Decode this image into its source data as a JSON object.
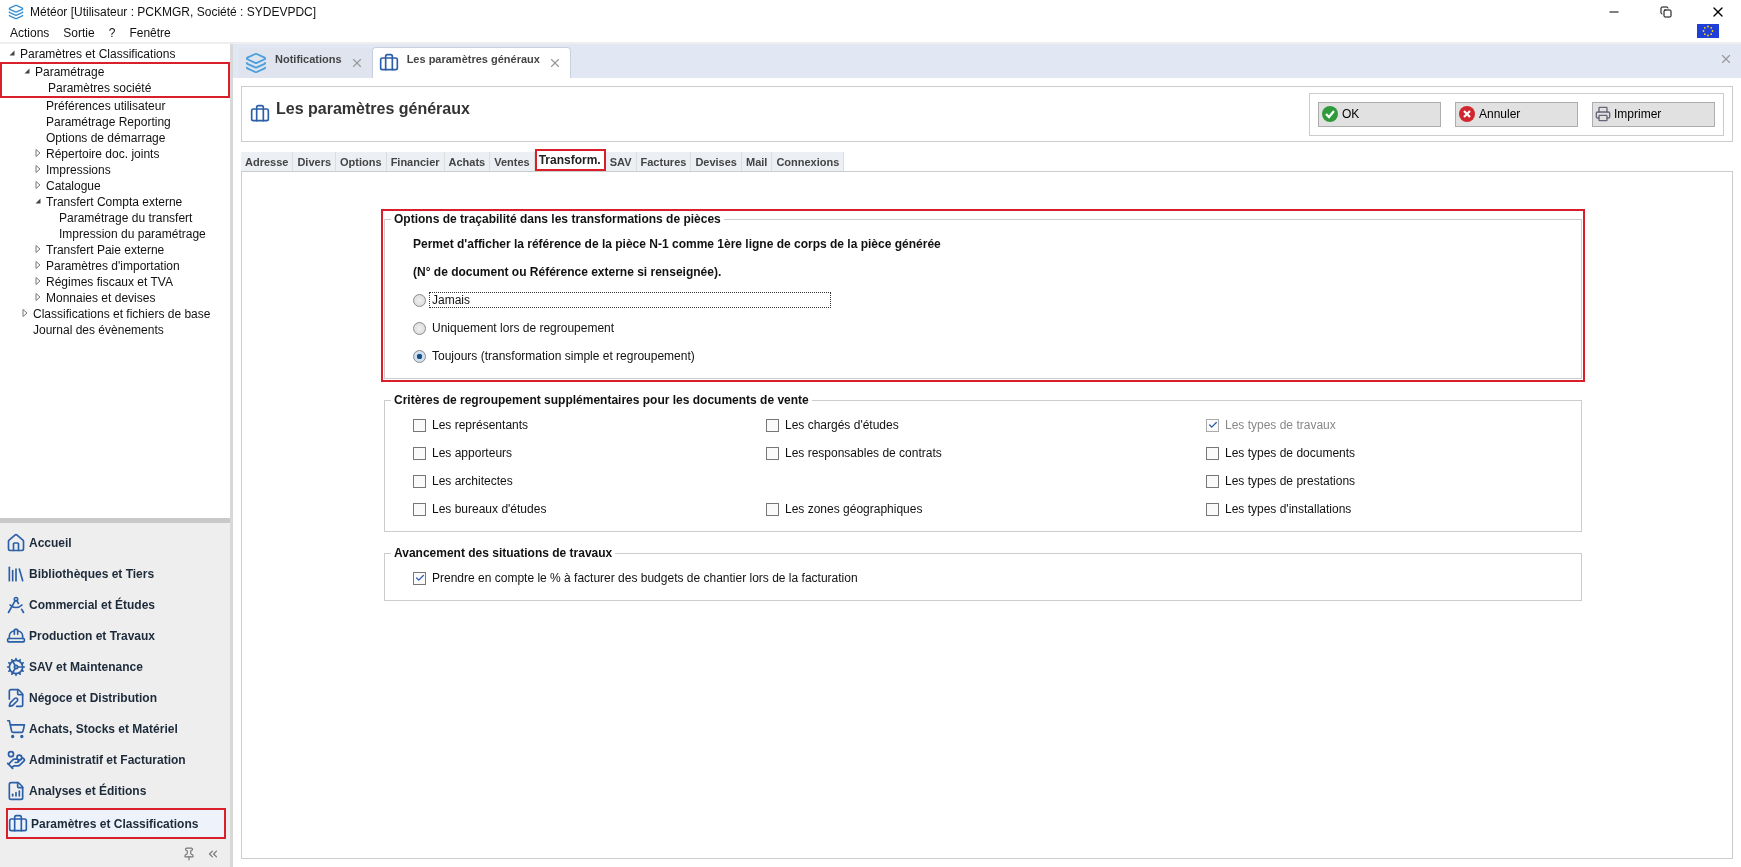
{
  "window": {
    "title": "Météor [Utilisateur : PCKMGR, Société : SYDEVPDC]"
  },
  "menu": [
    "Actions",
    "Sortie",
    "?",
    "Fenêtre"
  ],
  "tree": [
    {
      "label": "Paramètres et Classifications",
      "expanded": true,
      "children": [
        {
          "label": "Paramétrage",
          "expanded": true,
          "highlighted": true,
          "children": [
            {
              "label": "Paramètres société",
              "highlighted": true
            },
            {
              "label": "Préférences utilisateur"
            },
            {
              "label": "Paramétrage Reporting"
            },
            {
              "label": "Options de démarrage"
            },
            {
              "label": "Répertoire doc. joints",
              "expanded": false
            },
            {
              "label": "Impressions",
              "expanded": false
            },
            {
              "label": "Catalogue",
              "expanded": false
            },
            {
              "label": "Transfert Compta externe",
              "expanded": true,
              "children": [
                {
                  "label": "Paramétrage du transfert"
                },
                {
                  "label": "Impression du paramétrage"
                }
              ]
            },
            {
              "label": "Transfert Paie externe",
              "expanded": false
            },
            {
              "label": "Paramètres d'importation",
              "expanded": false
            },
            {
              "label": "Régimes fiscaux et TVA",
              "expanded": false
            },
            {
              "label": "Monnaies et devises",
              "expanded": false
            }
          ]
        },
        {
          "label": "Classifications et fichiers de base",
          "expanded": false
        },
        {
          "label": "Journal des évènements"
        }
      ]
    }
  ],
  "nav": [
    {
      "label": "Accueil",
      "highlighted": false
    },
    {
      "label": "Bibliothèques et Tiers",
      "highlighted": false
    },
    {
      "label": "Commercial et Études",
      "highlighted": false
    },
    {
      "label": "Production et Travaux",
      "highlighted": false
    },
    {
      "label": "SAV et Maintenance",
      "highlighted": false
    },
    {
      "label": "Négoce et Distribution",
      "highlighted": false
    },
    {
      "label": "Achats, Stocks et Matériel",
      "highlighted": false
    },
    {
      "label": "Administratif et Facturation",
      "highlighted": false
    },
    {
      "label": "Analyses et Éditions",
      "highlighted": false
    },
    {
      "label": "Paramètres et Classifications",
      "highlighted": true
    }
  ],
  "doc_tabs": [
    {
      "label": "Notifications",
      "selected": false
    },
    {
      "label": "Les paramètres généraux",
      "selected": true
    }
  ],
  "page_title": "Les paramètres généraux",
  "buttons": [
    "OK",
    "Annuler",
    "Imprimer"
  ],
  "tabs": [
    {
      "label": "Adresse",
      "selected": false,
      "highlighted": false
    },
    {
      "label": "Divers",
      "selected": false,
      "highlighted": false
    },
    {
      "label": "Options",
      "selected": false,
      "highlighted": false
    },
    {
      "label": "Financier",
      "selected": false,
      "highlighted": false
    },
    {
      "label": "Achats",
      "selected": false,
      "highlighted": false
    },
    {
      "label": "Ventes",
      "selected": false,
      "highlighted": false
    },
    {
      "label": "Transform.",
      "selected": true,
      "highlighted": true
    },
    {
      "label": "SAV",
      "selected": false,
      "highlighted": false
    },
    {
      "label": "Factures",
      "selected": false,
      "highlighted": false
    },
    {
      "label": "Devises",
      "selected": false,
      "highlighted": false
    },
    {
      "label": "Mail",
      "selected": false,
      "highlighted": false
    },
    {
      "label": "Connexions",
      "selected": false,
      "highlighted": false
    }
  ],
  "traceability": {
    "title": "Options de traçabilité dans les transformations de pièces",
    "highlighted": true,
    "description": [
      "Permet d'afficher la référence de la pièce N-1 comme 1ère ligne de corps de la pièce générée",
      "(N° de document ou Référence externe si renseignée)."
    ],
    "options": [
      {
        "label": "Jamais",
        "selected": false,
        "focused": true
      },
      {
        "label": "Uniquement lors de regroupement",
        "selected": false,
        "focused": false
      },
      {
        "label": "Toujours (transformation simple et regroupement)",
        "selected": true,
        "focused": false
      }
    ]
  },
  "grouping": {
    "title": "Critères de regroupement supplémentaires pour les documents de vente",
    "rows": [
      {
        "cells": [
          {
            "kind": "checkbox",
            "label": "Les représentants",
            "checked": false,
            "disabled": false
          },
          {
            "kind": "checkbox",
            "label": "Les chargés d'études",
            "checked": false,
            "disabled": false
          },
          {
            "kind": "checkbox",
            "label": "Les types de travaux",
            "checked": true,
            "disabled": true
          }
        ]
      },
      {
        "cells": [
          {
            "kind": "checkbox",
            "label": "Les apporteurs",
            "checked": false,
            "disabled": false
          },
          {
            "kind": "checkbox",
            "label": "Les responsables de contrats",
            "checked": false,
            "disabled": false
          },
          {
            "kind": "checkbox",
            "label": "Les types de documents",
            "checked": false,
            "disabled": false
          }
        ]
      },
      {
        "cells": [
          {
            "kind": "checkbox",
            "label": "Les architectes",
            "checked": false,
            "disabled": false
          },
          {
            "kind": "blank"
          },
          {
            "kind": "checkbox",
            "label": "Les types de prestations",
            "checked": false,
            "disabled": false
          }
        ]
      },
      {
        "cells": [
          {
            "kind": "checkbox",
            "label": "Les bureaux d'études",
            "checked": false,
            "disabled": false
          },
          {
            "kind": "checkbox",
            "label": "Les zones géographiques",
            "checked": false,
            "disabled": false
          },
          {
            "kind": "checkbox",
            "label": "Les types d'installations",
            "checked": false,
            "disabled": false
          }
        ]
      }
    ]
  },
  "progress": {
    "title": "Avancement des situations de travaux",
    "items": [
      {
        "label": "Prendre en compte le % à facturer des budgets de chantier lors de la facturation",
        "checked": true,
        "disabled": false
      }
    ]
  }
}
